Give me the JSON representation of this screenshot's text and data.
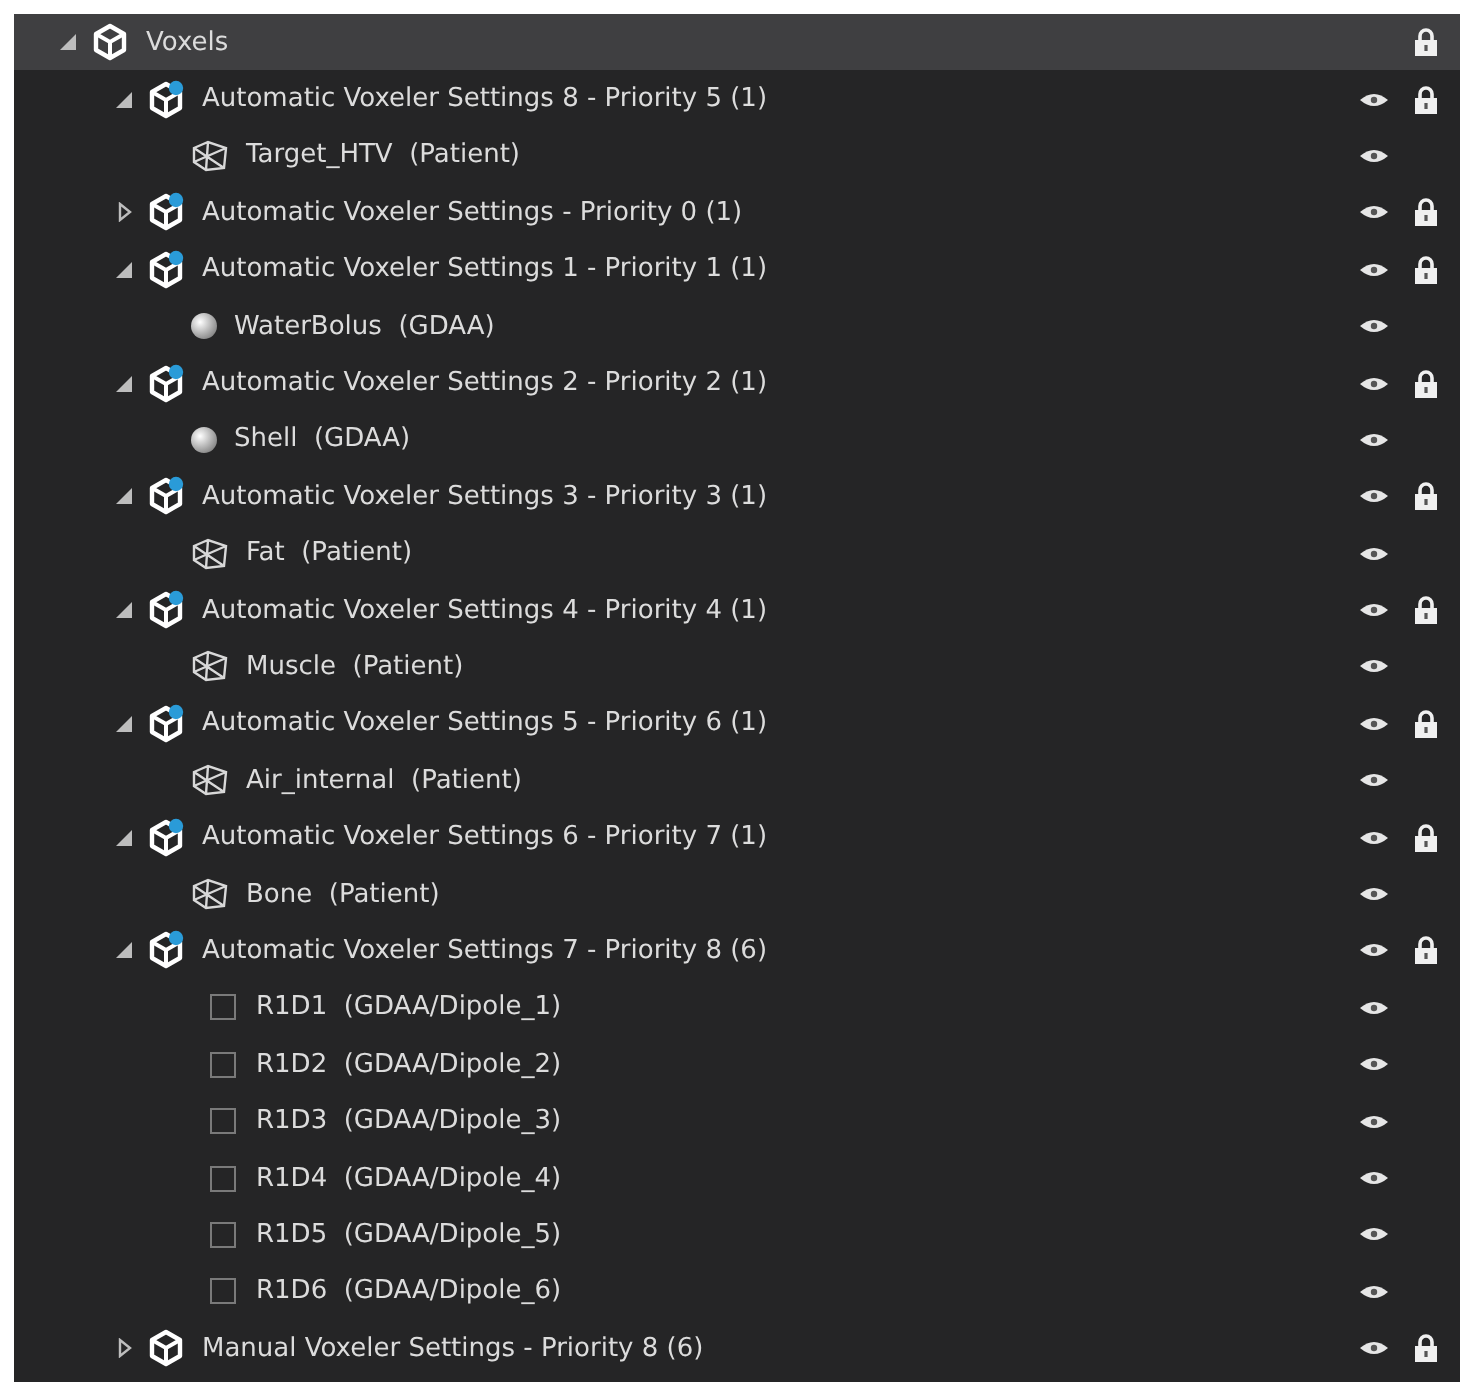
{
  "tree": [
    {
      "label": "Voxels",
      "kind": "cube",
      "expanded": true,
      "selected": true,
      "eye": false,
      "lock": true,
      "children": [
        {
          "label": "Automatic Voxeler Settings 8 - Priority 5 (1)",
          "kind": "auto",
          "expanded": true,
          "selected": false,
          "eye": true,
          "lock": true,
          "children": [
            {
              "label": "Target_HTV  (Patient)",
              "kind": "mesh",
              "selected": false,
              "eye": true,
              "lock": false
            }
          ]
        },
        {
          "label": "Automatic Voxeler Settings - Priority 0 (1)",
          "kind": "auto",
          "expanded": false,
          "selected": false,
          "eye": true,
          "lock": true
        },
        {
          "label": "Automatic Voxeler Settings 1 - Priority 1 (1)",
          "kind": "auto",
          "expanded": true,
          "selected": false,
          "eye": true,
          "lock": true,
          "children": [
            {
              "label": "WaterBolus  (GDAA)",
              "kind": "sphere",
              "selected": false,
              "eye": true,
              "lock": false
            }
          ]
        },
        {
          "label": "Automatic Voxeler Settings 2 - Priority 2 (1)",
          "kind": "auto",
          "expanded": true,
          "selected": false,
          "eye": true,
          "lock": true,
          "children": [
            {
              "label": "Shell  (GDAA)",
              "kind": "sphere",
              "selected": false,
              "eye": true,
              "lock": false
            }
          ]
        },
        {
          "label": "Automatic Voxeler Settings 3 - Priority 3 (1)",
          "kind": "auto",
          "expanded": true,
          "selected": false,
          "eye": true,
          "lock": true,
          "children": [
            {
              "label": "Fat  (Patient)",
              "kind": "mesh",
              "selected": false,
              "eye": true,
              "lock": false
            }
          ]
        },
        {
          "label": "Automatic Voxeler Settings 4 - Priority 4 (1)",
          "kind": "auto",
          "expanded": true,
          "selected": false,
          "eye": true,
          "lock": true,
          "children": [
            {
              "label": "Muscle  (Patient)",
              "kind": "mesh",
              "selected": false,
              "eye": true,
              "lock": false
            }
          ]
        },
        {
          "label": "Automatic Voxeler Settings 5 - Priority 6 (1)",
          "kind": "auto",
          "expanded": true,
          "selected": false,
          "eye": true,
          "lock": true,
          "children": [
            {
              "label": "Air_internal  (Patient)",
              "kind": "mesh",
              "selected": false,
              "eye": true,
              "lock": false
            }
          ]
        },
        {
          "label": "Automatic Voxeler Settings 6 - Priority 7 (1)",
          "kind": "auto",
          "expanded": true,
          "selected": false,
          "eye": true,
          "lock": true,
          "children": [
            {
              "label": "Bone  (Patient)",
              "kind": "mesh",
              "selected": false,
              "eye": true,
              "lock": false
            }
          ]
        },
        {
          "label": "Automatic Voxeler Settings 7 - Priority 8 (6)",
          "kind": "auto",
          "expanded": true,
          "selected": false,
          "eye": true,
          "lock": true,
          "children": [
            {
              "label": "R1D1  (GDAA/Dipole_1)",
              "kind": "check",
              "checked": false,
              "selected": false,
              "eye": true,
              "lock": false
            },
            {
              "label": "R1D2  (GDAA/Dipole_2)",
              "kind": "check",
              "checked": false,
              "selected": false,
              "eye": true,
              "lock": false
            },
            {
              "label": "R1D3  (GDAA/Dipole_3)",
              "kind": "check",
              "checked": false,
              "selected": false,
              "eye": true,
              "lock": false
            },
            {
              "label": "R1D4  (GDAA/Dipole_4)",
              "kind": "check",
              "checked": false,
              "selected": false,
              "eye": true,
              "lock": false
            },
            {
              "label": "R1D5  (GDAA/Dipole_5)",
              "kind": "check",
              "checked": false,
              "selected": false,
              "eye": true,
              "lock": false
            },
            {
              "label": "R1D6  (GDAA/Dipole_6)",
              "kind": "check",
              "checked": false,
              "selected": false,
              "eye": true,
              "lock": false
            }
          ]
        },
        {
          "label": "Manual Voxeler Settings - Priority 8 (6)",
          "kind": "cube",
          "expanded": false,
          "selected": false,
          "eye": true,
          "lock": true
        }
      ]
    }
  ]
}
